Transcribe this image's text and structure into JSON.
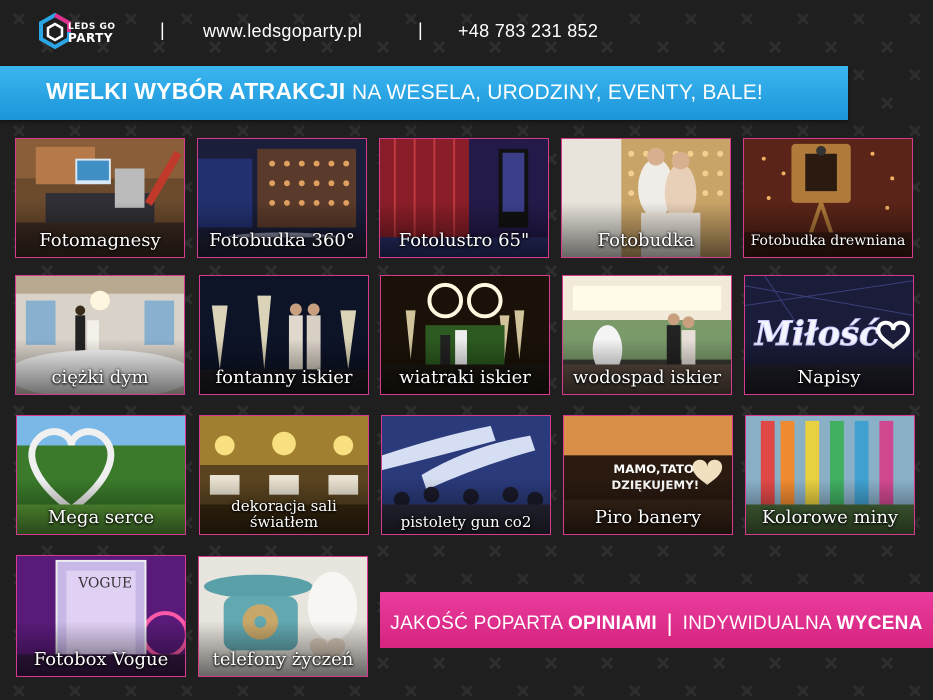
{
  "header": {
    "logo_line1": "LEDS GO",
    "logo_line2": "PARTY",
    "separator": "|",
    "website": "www.ledsgoparty.pl",
    "phone": "+48 783 231 852"
  },
  "banner": {
    "bold_text": "Wielki wybór atrakcji",
    "regular_text": "na wesela, urodziny, eventy, bale!"
  },
  "tiles": [
    {
      "label": "Fotomagnesy"
    },
    {
      "label": "Fotobudka 360°"
    },
    {
      "label": "Fotolustro 65\""
    },
    {
      "label": "Fotobudka"
    },
    {
      "label": "Fotobudka drewniana"
    },
    {
      "label": "ciężki dym"
    },
    {
      "label": "fontanny iskier"
    },
    {
      "label": "wiatraki iskier"
    },
    {
      "label": "wodospad iskier"
    },
    {
      "label": "Napisy"
    },
    {
      "label": "Mega serce"
    },
    {
      "label": "dekoracja sali światłem"
    },
    {
      "label": "pistolety gun co2"
    },
    {
      "label": "Piro banery"
    },
    {
      "label": "Kolorowe miny"
    },
    {
      "label": "Fotobox Vogue"
    },
    {
      "label": "telefony życzeń"
    }
  ],
  "footer_banner": {
    "part1": "Jakość poparta",
    "part1_bold": "opiniami",
    "divider": "|",
    "part2": "Indywidualna",
    "part2_bold": "wycena"
  },
  "colors": {
    "background": "#1f1f1f",
    "banner_blue": "#2aa6e6",
    "accent_pink": "#e02f8c"
  }
}
